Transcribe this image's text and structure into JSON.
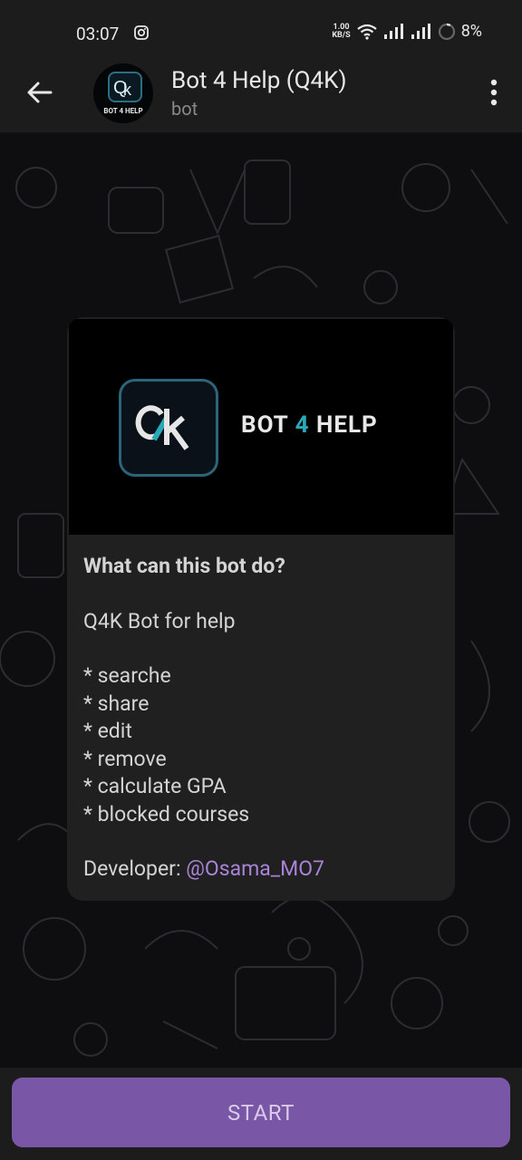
{
  "status_bar": {
    "time": "03:07",
    "net_speed_value": "1.00",
    "net_speed_unit": "KB/S",
    "battery": "8%"
  },
  "header": {
    "title": "Bot 4 Help (Q4K)",
    "subtitle": "bot",
    "avatar_caption": "BOT 4 HELP"
  },
  "card": {
    "banner_text_1": "BOT ",
    "banner_text_4": "4",
    "banner_text_2": " HELP",
    "question": "What can this bot do?",
    "description": "Q4K Bot for help",
    "features": [
      "* searche",
      "* share",
      "* edit",
      "* remove",
      "* calculate GPA",
      "* blocked courses"
    ],
    "developer_label": "Developer: ",
    "developer_handle": "@Osama_MO7"
  },
  "bottom": {
    "start_label": "START"
  },
  "colors": {
    "accent": "#7a56a6",
    "link": "#a983d6",
    "teal": "#2aa9b9"
  }
}
